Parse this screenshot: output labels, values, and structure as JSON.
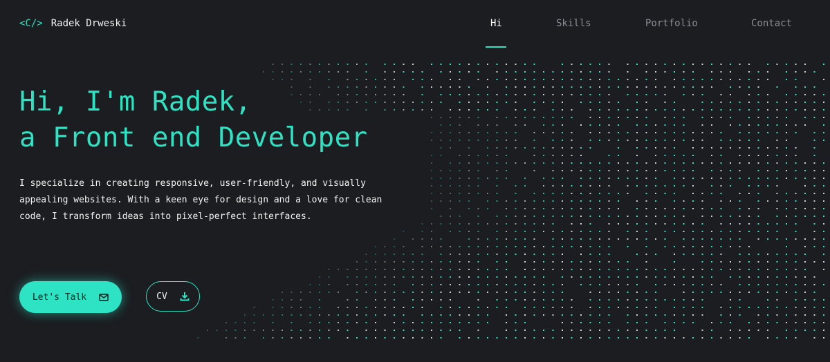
{
  "brand": {
    "mark": "<C/>",
    "name": "Radek Drweski"
  },
  "nav": {
    "items": [
      {
        "label": "Hi",
        "active": true
      },
      {
        "label": "Skills",
        "active": false
      },
      {
        "label": "Portfolio",
        "active": false
      },
      {
        "label": "Contact",
        "active": false
      }
    ]
  },
  "hero": {
    "title_line1": "Hi, I'm Radek,",
    "title_line2": "a Front end Developer",
    "description": "I specialize in creating responsive, user-friendly, and visually appealing websites. With a keen eye for design and a love for clean code, I transform ideas into pixel-perfect interfaces."
  },
  "actions": {
    "talk_label": "Let's Talk",
    "talk_icon": "mail-icon",
    "cv_label": "CV",
    "cv_icon": "download-icon"
  },
  "colors": {
    "accent": "#2de3c4",
    "background": "#1b1d21",
    "text": "#f2f2f2",
    "muted": "#8b8f94"
  }
}
